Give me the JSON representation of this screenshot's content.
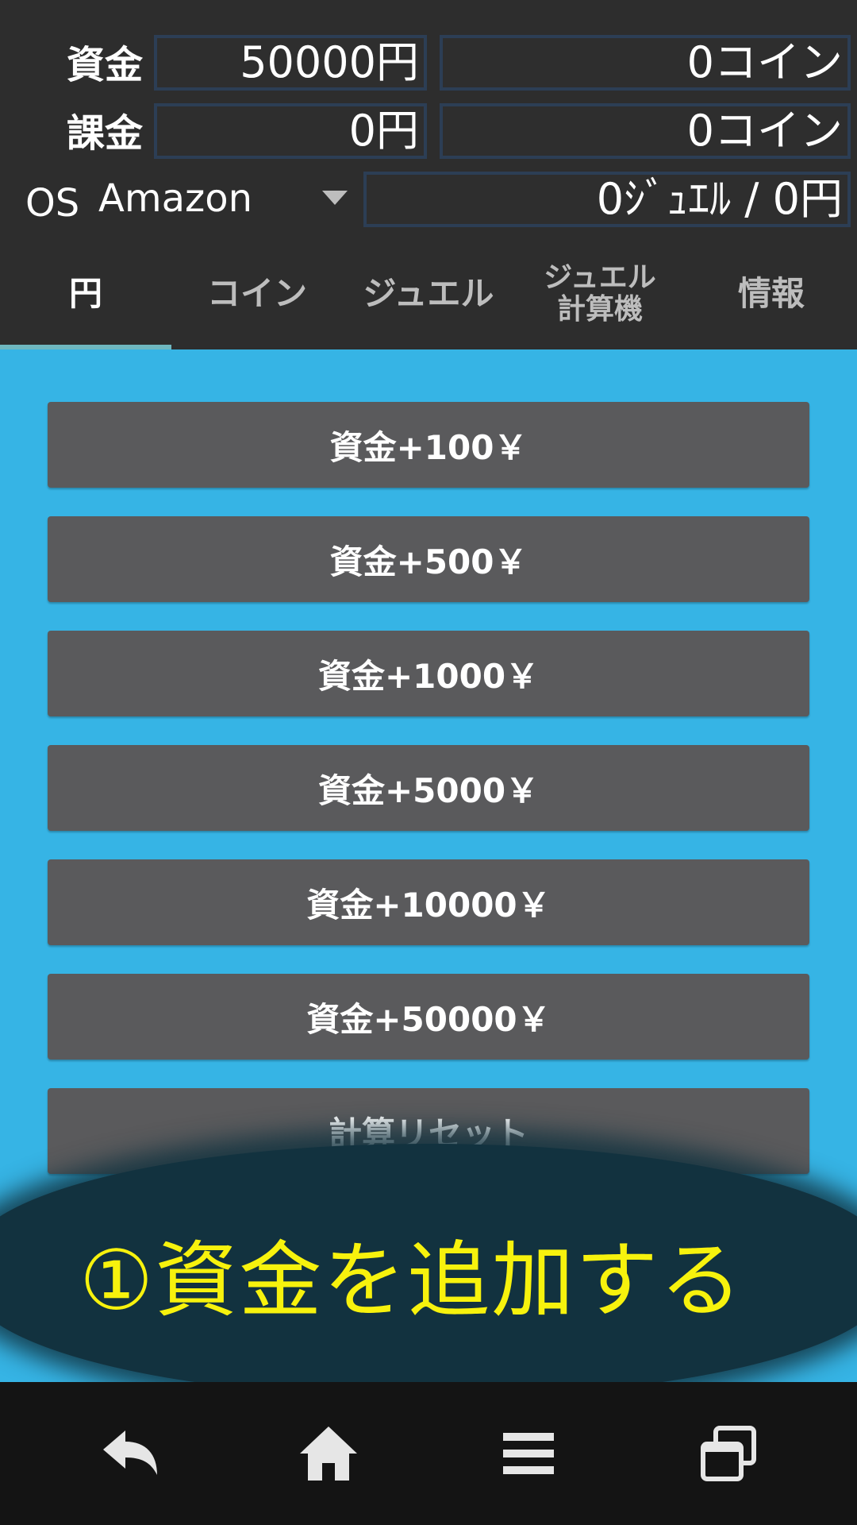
{
  "header": {
    "funds_label": "資金",
    "funds_yen": "50000円",
    "funds_coin": "0コイン",
    "billing_label": "課金",
    "billing_yen": "0円",
    "billing_coin": "0コイン",
    "os_label": "OS",
    "os_value": "Amazon",
    "jewel_summary": "0ｼﾞｭｴﾙ / 0円"
  },
  "tabs": [
    {
      "label": "円",
      "active": true
    },
    {
      "label": "コイン",
      "active": false
    },
    {
      "label": "ジュエル",
      "active": false
    },
    {
      "label": "ジュエル\n計算機",
      "active": false
    },
    {
      "label": "情報",
      "active": false
    }
  ],
  "buttons": [
    "資金+100￥",
    "資金+500￥",
    "資金+1000￥",
    "資金+5000￥",
    "資金+10000￥",
    "資金+50000￥",
    "計算リセット"
  ],
  "caption": "①資金を追加する",
  "colors": {
    "background": "#2d2d2d",
    "content": "#36b4e5",
    "button": "#5a5a5c",
    "caption": "#f7f20d",
    "tab_indicator": "#6fb7bf"
  },
  "nav_icons": [
    "back-icon",
    "home-icon",
    "menu-icon",
    "recent-apps-icon"
  ]
}
